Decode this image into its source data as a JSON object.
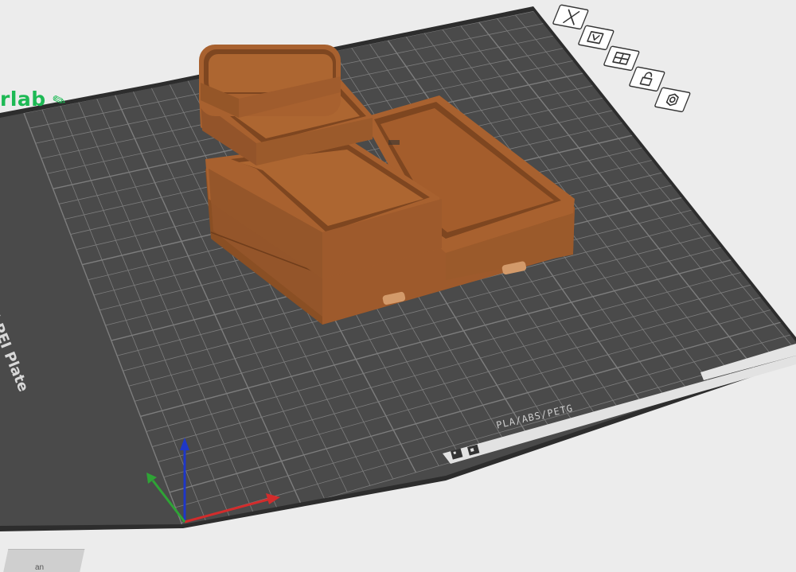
{
  "app": {
    "brand_partial": "rlab",
    "bottom_tab_partial": "an"
  },
  "bed": {
    "plate_label": "Textured PEI Plate",
    "material_label": "PLA/ABS/PETG",
    "colors": {
      "plate": "#4a4a4a",
      "grid_line": "#7d7d7d",
      "frame": "#333333",
      "model": "#a8612f",
      "model_dark": "#8a4f24",
      "model_light": "#bb7440",
      "background": "#ececec",
      "brand": "#1db954"
    }
  },
  "plate_toolbar": {
    "items": [
      {
        "id": "remove",
        "icon": "close-icon"
      },
      {
        "id": "arrange",
        "icon": "arrange-icon"
      },
      {
        "id": "auto-orient",
        "icon": "orient-icon"
      },
      {
        "id": "lock",
        "icon": "lock-icon"
      },
      {
        "id": "settings",
        "icon": "gear-icon"
      }
    ]
  },
  "axes": {
    "x_color": "#d22c2c",
    "y_color": "#2fa336",
    "z_color": "#1e37c8"
  }
}
